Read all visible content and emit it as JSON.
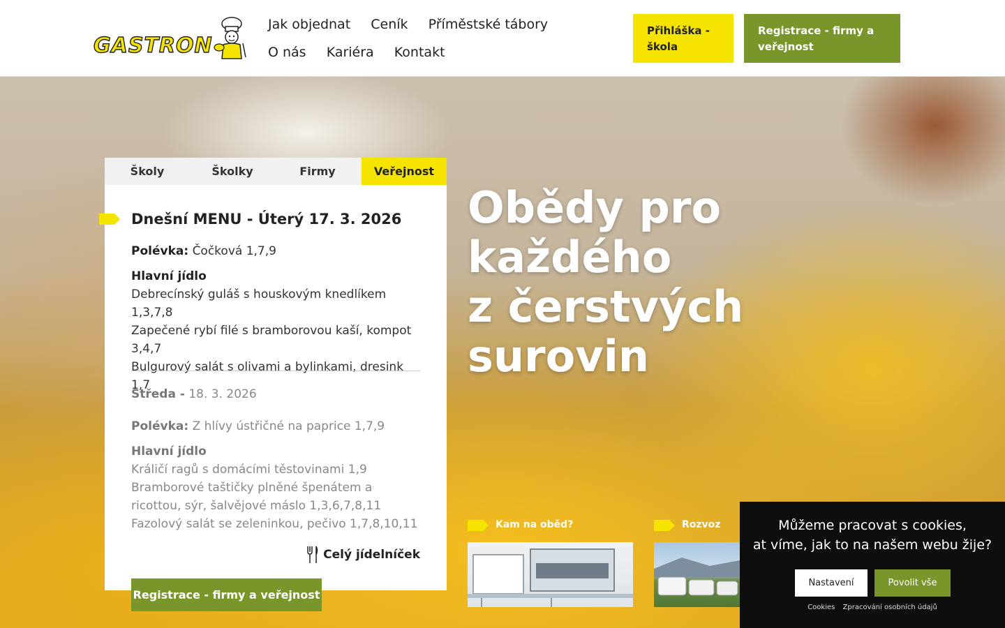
{
  "header": {
    "logo_text": "GASTRON",
    "nav": [
      "Jak objednat",
      "Ceník",
      "Příměstské tábory",
      "O nás",
      "Kariéra",
      "Kontakt"
    ],
    "btn_school": "Přihláška - škola",
    "btn_register": "Registrace - firmy a veřejnost"
  },
  "hero": {
    "title_lines": [
      "Obědy pro",
      "každého",
      "z čerstvých",
      "surovin"
    ]
  },
  "menu": {
    "tabs": [
      "Školy",
      "Školky",
      "Firmy",
      "Veřejnost"
    ],
    "active_tab": "Veřejnost",
    "today_title": "Dnešní MENU - Úterý 17. 3. 2026",
    "today": {
      "soup_label": "Polévka:",
      "soup": "Čočková 1,7,9",
      "main_label": "Hlavní jídlo",
      "mains": [
        "Debrecínský guláš s houskovým knedlíkem 1,3,7,8",
        "Zapečené rybí filé s bramborovou kaší, kompot 3,4,7",
        "Bulgurový salát s olivami a bylinkami, dresink 1,7"
      ]
    },
    "next_day_label": "Středa -",
    "next_day_date": "18. 3. 2026",
    "next": {
      "soup_label": "Polévka:",
      "soup": "Z hlívy ústřičné na paprice 1,7,9",
      "main_label": "Hlavní jídlo",
      "mains": [
        "Králičí ragů s domácími těstovinami 1,9",
        "Bramborové taštičky plněné špenátem a ricottou, sýr, šalvějové máslo 1,3,6,7,8,11",
        "Fazolový salát se zeleninkou, pečivo 1,7,8,10,11"
      ]
    },
    "full_menu_link": "Celý jídelníček",
    "register_button": "Registrace - firmy a veřejnost"
  },
  "tiles": [
    {
      "label": "Kam na oběd?"
    },
    {
      "label": "Rozvoz"
    }
  ],
  "cookie": {
    "line1": "Můžeme pracovat s cookies,",
    "line2": "at víme, jak to na našem webu žije?",
    "settings_button": "Nastavení",
    "allow_button": "Povolit vše",
    "links": [
      "Cookies",
      "Zpracování osobních údajů"
    ]
  },
  "colors": {
    "brand_yellow": "#f4e400",
    "brand_green": "#7a962a",
    "cookie_bg": "#0e0e0e"
  }
}
